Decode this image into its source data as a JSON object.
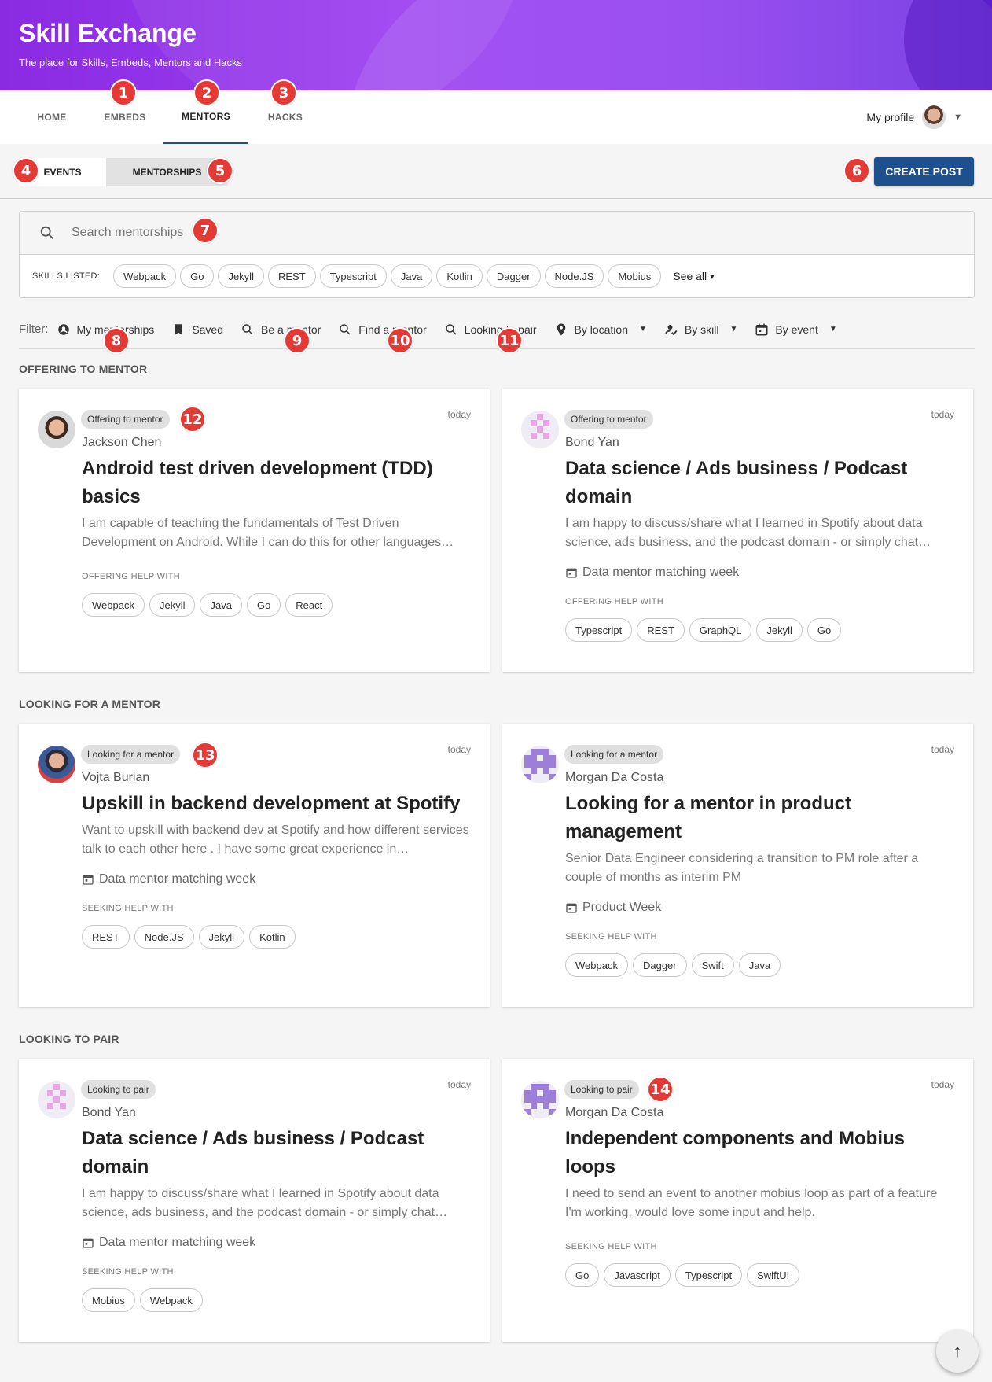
{
  "app": {
    "title": "Skill Exchange",
    "subtitle": "The place for Skills, Embeds, Mentors and Hacks"
  },
  "nav": {
    "tabs": [
      "HOME",
      "EMBEDS",
      "MENTORS",
      "HACKS"
    ],
    "active": "MENTORS",
    "profile_label": "My profile"
  },
  "toolbar": {
    "events_label": "EVENTS",
    "mentorships_label": "MENTORSHIPS",
    "create_label": "CREATE POST"
  },
  "search": {
    "placeholder": "Search mentorships"
  },
  "skills": {
    "label": "SKILLS LISTED:",
    "items": [
      "Webpack",
      "Go",
      "Jekyll",
      "REST",
      "Typescript",
      "Java",
      "Kotlin",
      "Dagger",
      "Node.JS",
      "Mobius"
    ],
    "see_all": "See all"
  },
  "filters": {
    "label": "Filter:",
    "items": [
      "My mentorships",
      "Saved",
      "Be a mentor",
      "Find a mentor",
      "Looking to pair",
      "By location",
      "By skill",
      "By event"
    ]
  },
  "sections": {
    "offering": "OFFERING TO MENTOR",
    "looking": "LOOKING FOR A MENTOR",
    "pair": "LOOKING TO PAIR"
  },
  "cards": [
    {
      "badge": "Offering to mentor",
      "time": "today",
      "author": "Jackson Chen",
      "title": "Android test driven development (TDD) basics",
      "desc": "I am capable of teaching the fundamentals of Test Driven Development on Android. While I can do this for other languages…",
      "event": "",
      "help_label": "OFFERING HELP WITH",
      "tags": [
        "Webpack",
        "Jekyll",
        "Java",
        "Go",
        "React"
      ]
    },
    {
      "badge": "Offering to mentor",
      "time": "today",
      "author": "Bond Yan",
      "title": "Data science / Ads business / Podcast domain",
      "desc": "I am happy to discuss/share what I learned in Spotify about data science, ads business, and the podcast domain - or simply chat…",
      "event": "Data mentor matching week",
      "help_label": "OFFERING HELP WITH",
      "tags": [
        "Typescript",
        "REST",
        "GraphQL",
        "Jekyll",
        "Go"
      ]
    },
    {
      "badge": "Looking for a mentor",
      "time": "today",
      "author": "Vojta Burian",
      "title": "Upskill in backend development at Spotify",
      "desc": "Want to upskill with backend dev at Spotify and how different services talk to each other here . I have some great experience in…",
      "event": "Data mentor matching week",
      "help_label": "SEEKING HELP WITH",
      "tags": [
        "REST",
        "Node.JS",
        "Jekyll",
        "Kotlin"
      ]
    },
    {
      "badge": "Looking for a mentor",
      "time": "today",
      "author": "Morgan Da Costa",
      "title": "Looking for a mentor in product management",
      "desc": "Senior Data Engineer considering a transition to PM role after a couple of months as interim PM",
      "event": "Product Week",
      "help_label": "SEEKING HELP WITH",
      "tags": [
        "Webpack",
        "Dagger",
        "Swift",
        "Java"
      ]
    },
    {
      "badge": "Looking to pair",
      "time": "today",
      "author": "Bond Yan",
      "title": "Data science / Ads business / Podcast domain",
      "desc": "I am happy to discuss/share what I learned in Spotify about data science, ads business, and the podcast domain - or simply chat…",
      "event": "Data mentor matching week",
      "help_label": "SEEKING HELP WITH",
      "tags": [
        "Mobius",
        "Webpack"
      ]
    },
    {
      "badge": "Looking to pair",
      "time": "today",
      "author": "Morgan Da Costa",
      "title": "Independent components and Mobius loops",
      "desc": "I need to send an event to another mobius loop as part of a feature I'm working, would love some input and help.",
      "event": "",
      "help_label": "SEEKING HELP WITH",
      "tags": [
        "Go",
        "Javascript",
        "Typescript",
        "SwiftUI"
      ]
    }
  ],
  "callouts": [
    "1",
    "2",
    "3",
    "4",
    "5",
    "6",
    "7",
    "8",
    "9",
    "10",
    "11",
    "12",
    "13",
    "14"
  ],
  "colors": {
    "primary": "#1e4f8f",
    "header_gradient": "#8a2be2",
    "callout": "#e53935"
  }
}
